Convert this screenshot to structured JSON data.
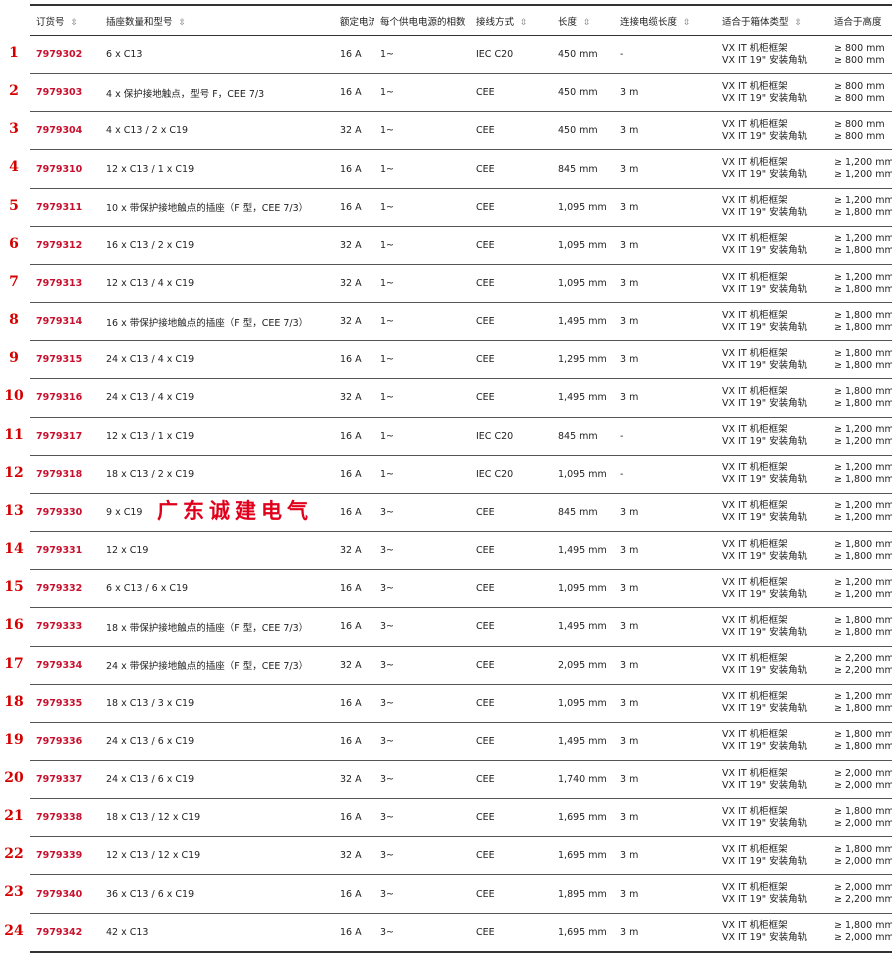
{
  "columns": [
    {
      "key": "order",
      "label": "订货号",
      "sortable": true
    },
    {
      "key": "sockets",
      "label": "插座数量和型号",
      "sortable": true
    },
    {
      "key": "current",
      "label": "额定电流",
      "sortable": false
    },
    {
      "key": "phases",
      "label": "每个供电电源的相数",
      "sortable": false
    },
    {
      "key": "connection",
      "label": "接线方式",
      "sortable": true
    },
    {
      "key": "length",
      "label": "长度",
      "sortable": true
    },
    {
      "key": "cable",
      "label": "连接电缆长度",
      "sortable": true
    },
    {
      "key": "enclosure",
      "label": "适合于箱体类型",
      "sortable": true
    },
    {
      "key": "height",
      "label": "适合于高度",
      "sortable": false
    }
  ],
  "enclosure_lines": [
    "VX IT 机柜框架",
    "VX IT 19\" 安装角轨"
  ],
  "watermark": "广东诚建电气",
  "rows": [
    {
      "num": "1",
      "order": "7979302",
      "sockets": "6 x C13",
      "current": "16 A",
      "phases": "1~",
      "connection": "IEC C20",
      "length": "450 mm",
      "cable": "-",
      "h1": "≥ 800 mm",
      "h2": "≥ 800 mm"
    },
    {
      "num": "2",
      "order": "7979303",
      "sockets": "4 x 保护接地触点，型号 F，CEE 7/3",
      "current": "16 A",
      "phases": "1~",
      "connection": "CEE",
      "length": "450 mm",
      "cable": "3 m",
      "h1": "≥ 800 mm",
      "h2": "≥ 800 mm"
    },
    {
      "num": "3",
      "order": "7979304",
      "sockets": "4 x C13 / 2 x C19",
      "current": "32 A",
      "phases": "1~",
      "connection": "CEE",
      "length": "450 mm",
      "cable": "3 m",
      "h1": "≥ 800 mm",
      "h2": "≥ 800 mm"
    },
    {
      "num": "4",
      "order": "7979310",
      "sockets": "12 x C13 / 1 x C19",
      "current": "16 A",
      "phases": "1~",
      "connection": "CEE",
      "length": "845 mm",
      "cable": "3 m",
      "h1": "≥ 1,200 mm",
      "h2": "≥ 1,200 mm"
    },
    {
      "num": "5",
      "order": "7979311",
      "sockets": "10 x 带保护接地触点的插座（F 型，CEE 7/3）",
      "current": "16 A",
      "phases": "1~",
      "connection": "CEE",
      "length": "1,095 mm",
      "cable": "3 m",
      "h1": "≥ 1,200 mm",
      "h2": "≥ 1,800 mm"
    },
    {
      "num": "6",
      "order": "7979312",
      "sockets": "16 x C13 / 2 x C19",
      "current": "32 A",
      "phases": "1~",
      "connection": "CEE",
      "length": "1,095 mm",
      "cable": "3 m",
      "h1": "≥ 1,200 mm",
      "h2": "≥ 1,800 mm"
    },
    {
      "num": "7",
      "order": "7979313",
      "sockets": "12 x C13 / 4 x C19",
      "current": "32 A",
      "phases": "1~",
      "connection": "CEE",
      "length": "1,095 mm",
      "cable": "3 m",
      "h1": "≥ 1,200 mm",
      "h2": "≥ 1,800 mm"
    },
    {
      "num": "8",
      "order": "7979314",
      "sockets": "16 x 带保护接地触点的插座（F 型，CEE 7/3）",
      "current": "32 A",
      "phases": "1~",
      "connection": "CEE",
      "length": "1,495 mm",
      "cable": "3 m",
      "h1": "≥ 1,800 mm",
      "h2": "≥ 1,800 mm"
    },
    {
      "num": "9",
      "order": "7979315",
      "sockets": "24 x C13 / 4 x C19",
      "current": "16 A",
      "phases": "1~",
      "connection": "CEE",
      "length": "1,295 mm",
      "cable": "3 m",
      "h1": "≥ 1,800 mm",
      "h2": "≥ 1,800 mm"
    },
    {
      "num": "10",
      "order": "7979316",
      "sockets": "24 x C13 / 4 x C19",
      "current": "32 A",
      "phases": "1~",
      "connection": "CEE",
      "length": "1,495 mm",
      "cable": "3 m",
      "h1": "≥ 1,800 mm",
      "h2": "≥ 1,800 mm"
    },
    {
      "num": "11",
      "order": "7979317",
      "sockets": "12 x C13 / 1 x C19",
      "current": "16 A",
      "phases": "1~",
      "connection": "IEC C20",
      "length": "845 mm",
      "cable": "-",
      "h1": "≥ 1,200 mm",
      "h2": "≥ 1,200 mm"
    },
    {
      "num": "12",
      "order": "7979318",
      "sockets": "18 x C13 / 2 x C19",
      "current": "16 A",
      "phases": "1~",
      "connection": "IEC C20",
      "length": "1,095 mm",
      "cable": "-",
      "h1": "≥ 1,200 mm",
      "h2": "≥ 1,800 mm"
    },
    {
      "num": "13",
      "order": "7979330",
      "sockets": "9 x C19",
      "current": "16 A",
      "phases": "3~",
      "connection": "CEE",
      "length": "845 mm",
      "cable": "3 m",
      "h1": "≥ 1,200 mm",
      "h2": "≥ 1,200 mm"
    },
    {
      "num": "14",
      "order": "7979331",
      "sockets": "12 x C19",
      "current": "32 A",
      "phases": "3~",
      "connection": "CEE",
      "length": "1,495 mm",
      "cable": "3 m",
      "h1": "≥ 1,800 mm",
      "h2": "≥ 1,800 mm"
    },
    {
      "num": "15",
      "order": "7979332",
      "sockets": "6 x C13 / 6 x C19",
      "current": "16 A",
      "phases": "3~",
      "connection": "CEE",
      "length": "1,095 mm",
      "cable": "3 m",
      "h1": "≥ 1,200 mm",
      "h2": "≥ 1,200 mm"
    },
    {
      "num": "16",
      "order": "7979333",
      "sockets": "18 x 带保护接地触点的插座（F 型，CEE 7/3）",
      "current": "16 A",
      "phases": "3~",
      "connection": "CEE",
      "length": "1,495 mm",
      "cable": "3 m",
      "h1": "≥ 1,800 mm",
      "h2": "≥ 1,800 mm"
    },
    {
      "num": "17",
      "order": "7979334",
      "sockets": "24 x 带保护接地触点的插座（F 型，CEE 7/3）",
      "current": "32 A",
      "phases": "3~",
      "connection": "CEE",
      "length": "2,095 mm",
      "cable": "3 m",
      "h1": "≥ 2,200 mm",
      "h2": "≥ 2,200 mm"
    },
    {
      "num": "18",
      "order": "7979335",
      "sockets": "18 x C13 / 3 x C19",
      "current": "16 A",
      "phases": "3~",
      "connection": "CEE",
      "length": "1,095 mm",
      "cable": "3 m",
      "h1": "≥ 1,200 mm",
      "h2": "≥ 1,800 mm"
    },
    {
      "num": "19",
      "order": "7979336",
      "sockets": "24 x C13 / 6 x C19",
      "current": "16 A",
      "phases": "3~",
      "connection": "CEE",
      "length": "1,495 mm",
      "cable": "3 m",
      "h1": "≥ 1,800 mm",
      "h2": "≥ 1,800 mm"
    },
    {
      "num": "20",
      "order": "7979337",
      "sockets": "24 x C13 / 6 x C19",
      "current": "32 A",
      "phases": "3~",
      "connection": "CEE",
      "length": "1,740 mm",
      "cable": "3 m",
      "h1": "≥ 2,000 mm",
      "h2": "≥ 2,000 mm"
    },
    {
      "num": "21",
      "order": "7979338",
      "sockets": "18 x C13 / 12 x C19",
      "current": "16 A",
      "phases": "3~",
      "connection": "CEE",
      "length": "1,695 mm",
      "cable": "3 m",
      "h1": "≥ 1,800 mm",
      "h2": "≥ 2,000 mm"
    },
    {
      "num": "22",
      "order": "7979339",
      "sockets": "12 x C13 / 12 x C19",
      "current": "32 A",
      "phases": "3~",
      "connection": "CEE",
      "length": "1,695 mm",
      "cable": "3 m",
      "h1": "≥ 1,800 mm",
      "h2": "≥ 2,000 mm"
    },
    {
      "num": "23",
      "order": "7979340",
      "sockets": "36 x C13 / 6 x C19",
      "current": "16 A",
      "phases": "3~",
      "connection": "CEE",
      "length": "1,895 mm",
      "cable": "3 m",
      "h1": "≥ 2,000 mm",
      "h2": "≥ 2,200 mm"
    },
    {
      "num": "24",
      "order": "7979342",
      "sockets": "42 x C13",
      "current": "16 A",
      "phases": "3~",
      "connection": "CEE",
      "length": "1,695 mm",
      "cable": "3 m",
      "h1": "≥ 1,800 mm",
      "h2": "≥ 2,000 mm"
    }
  ]
}
